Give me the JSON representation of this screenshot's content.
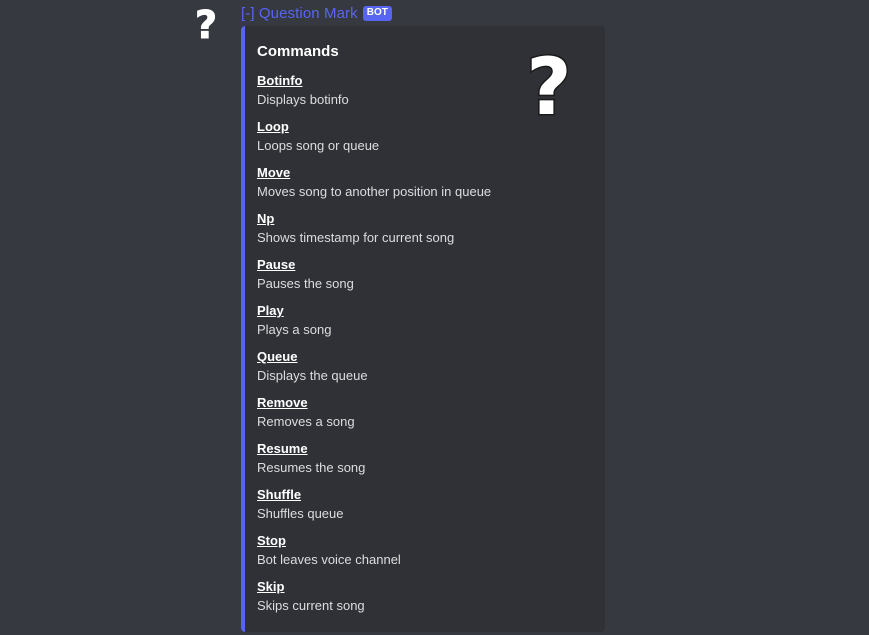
{
  "author": {
    "name": "[-] Question Mark",
    "bot_tag": "BOT",
    "avatar_icon": "question-mark-icon"
  },
  "embed": {
    "accent_color": "#5865f2",
    "title": "Commands",
    "thumbnail_icon": "question-mark-icon",
    "fields": [
      {
        "name": "Botinfo",
        "value": "Displays botinfo"
      },
      {
        "name": "Loop",
        "value": "Loops song or queue"
      },
      {
        "name": "Move",
        "value": "Moves song to another position in queue"
      },
      {
        "name": "Np",
        "value": "Shows timestamp for current song"
      },
      {
        "name": "Pause",
        "value": "Pauses the song"
      },
      {
        "name": "Play",
        "value": "Plays a song"
      },
      {
        "name": "Queue",
        "value": "Displays the queue"
      },
      {
        "name": "Remove",
        "value": "Removes a song"
      },
      {
        "name": "Resume",
        "value": "Resumes the song"
      },
      {
        "name": "Shuffle",
        "value": "Shuffles queue"
      },
      {
        "name": "Stop",
        "value": "Bot leaves voice channel"
      },
      {
        "name": "Skip",
        "value": "Skips current song"
      }
    ]
  },
  "colors": {
    "background": "#36393f",
    "embed_background": "#2f3136",
    "username": "#5865f2",
    "bot_tag": "#5865f2"
  }
}
